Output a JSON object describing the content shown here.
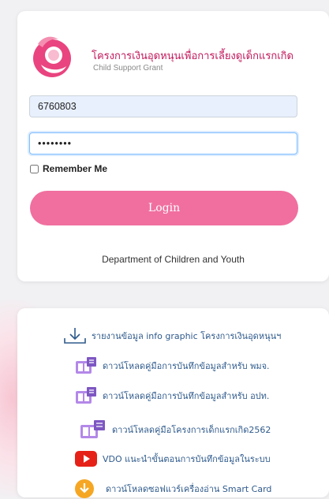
{
  "login": {
    "title_th": "โครงการเงินอุดหนุนเพื่อการเลี้ยงดูเด็กแรกเกิด",
    "subtitle_en": "Child Support Grant",
    "username_value": "6760803",
    "password_value": "••••••••",
    "remember_label": "Remember Me",
    "login_label": "Login",
    "department": "Department of Children and Youth"
  },
  "links": [
    {
      "icon": "download-arrow-icon",
      "label": "รายงานข้อมูล info graphic โครงการเงินอุดหนุนฯ"
    },
    {
      "icon": "manual-book-icon",
      "label": "ดาวน์โหลดคู่มือการบันทึกข้อมูลสำหรับ พมจ."
    },
    {
      "icon": "manual-book-icon",
      "label": "ดาวน์โหลดคู่มือการบันทึกข้อมูลสำหรับ อปท."
    },
    {
      "icon": "manual-book-icon",
      "label": "ดาวน์โหลดคู่มือโครงการเด็กแรกเกิด2562"
    },
    {
      "icon": "youtube-play-icon",
      "label": "VDO แนะนำขั้นตอนการบันทึกข้อมูลในระบบ"
    },
    {
      "icon": "download-circle-icon",
      "label": "ดาวน์โหลดซอฟแวร์เครื่องอ่าน Smart Card"
    }
  ],
  "colors": {
    "accent": "#f06f9f",
    "brand": "#c2185b",
    "link": "#2f5a8c"
  }
}
